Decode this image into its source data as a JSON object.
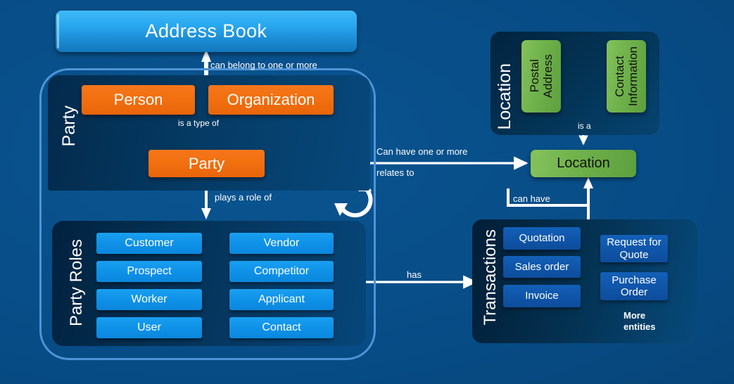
{
  "diagram": {
    "title": "Party / Address Book entity relationship diagram",
    "colors": {
      "background": "#074b84",
      "accent_blue": "#1a9ff0",
      "accent_orange": "#f2700f",
      "accent_green": "#6fb14b",
      "accent_navy": "#0f56aa",
      "container_border": "#4e94d6",
      "connector": "#ffffff"
    }
  },
  "address_book": {
    "label": "Address Book"
  },
  "party_group": {
    "label": "Party",
    "entities": [
      {
        "label": "Person"
      },
      {
        "label": "Organization"
      }
    ],
    "root_entity": {
      "label": "Party"
    }
  },
  "party_roles": {
    "label": "Party Roles",
    "column_left": [
      {
        "label": "Customer"
      },
      {
        "label": "Prospect"
      },
      {
        "label": "Worker"
      },
      {
        "label": "User"
      }
    ],
    "column_right": [
      {
        "label": "Vendor"
      },
      {
        "label": "Competitor"
      },
      {
        "label": "Applicant"
      },
      {
        "label": "Contact"
      }
    ]
  },
  "location_group": {
    "label": "Location",
    "entities": [
      {
        "label": "Postal\nAddress"
      },
      {
        "label": "Contact\nInformation"
      }
    ],
    "root_entity": {
      "label": "Location"
    }
  },
  "transactions_group": {
    "label": "Transactions",
    "column_left": [
      {
        "label": "Quotation"
      },
      {
        "label": "Sales order"
      },
      {
        "label": "Invoice"
      }
    ],
    "column_right": [
      {
        "label": "Request for\nQuote"
      },
      {
        "label": "Purchase\nOrder"
      }
    ],
    "more": {
      "label": "More\nentities"
    }
  },
  "relationships": {
    "can_belong": "can belong to one or more",
    "is_a_type_of": "is a type of",
    "plays_a_role_of": "plays a role of",
    "can_have_one_or_more": "Can have one or more",
    "relates_to": "relates to",
    "has": "has",
    "is_a": "is a",
    "can_have": "can have"
  }
}
